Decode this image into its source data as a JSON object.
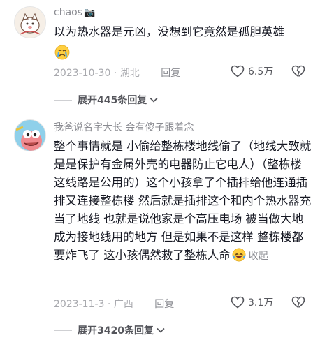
{
  "comments": [
    {
      "username": "chaos",
      "username_badge": "📷",
      "text": "以为热水器是元凶，没想到它竟然是孤胆英雄",
      "emoji": "crying-face",
      "date": "2023-10-30",
      "location": "湖北",
      "reply_label": "回复",
      "likes": "6.5万",
      "expand_label": "展开445条回复"
    },
    {
      "username": "我爸说名字大长 会有傻子跟着念",
      "text": "整个事情就是 小偷给整栋楼地线偷了（地线大致就是是保护有金属外壳的电器防止它电人）（整栋楼这线路是公用的）这个小孩拿了个插排给他连通插排又连接整栋楼 然后就是插排这个和内个热水器充当了地线 也就是说他家是个高压电场 被当做大地成为接地线用的地方 但是如果不是这样 整栋楼都要炸飞了 这小孩偶然救了整栋人命",
      "emoji": "laughing-face",
      "fold_label": "收起",
      "date": "2023-11-3",
      "location": "广西",
      "reply_label": "回复",
      "likes": "3.1万",
      "expand_label": "展开3420条回复"
    }
  ],
  "colors": {
    "text": "#161823",
    "meta": "#a8a9ae",
    "username": "#8a8b91"
  }
}
